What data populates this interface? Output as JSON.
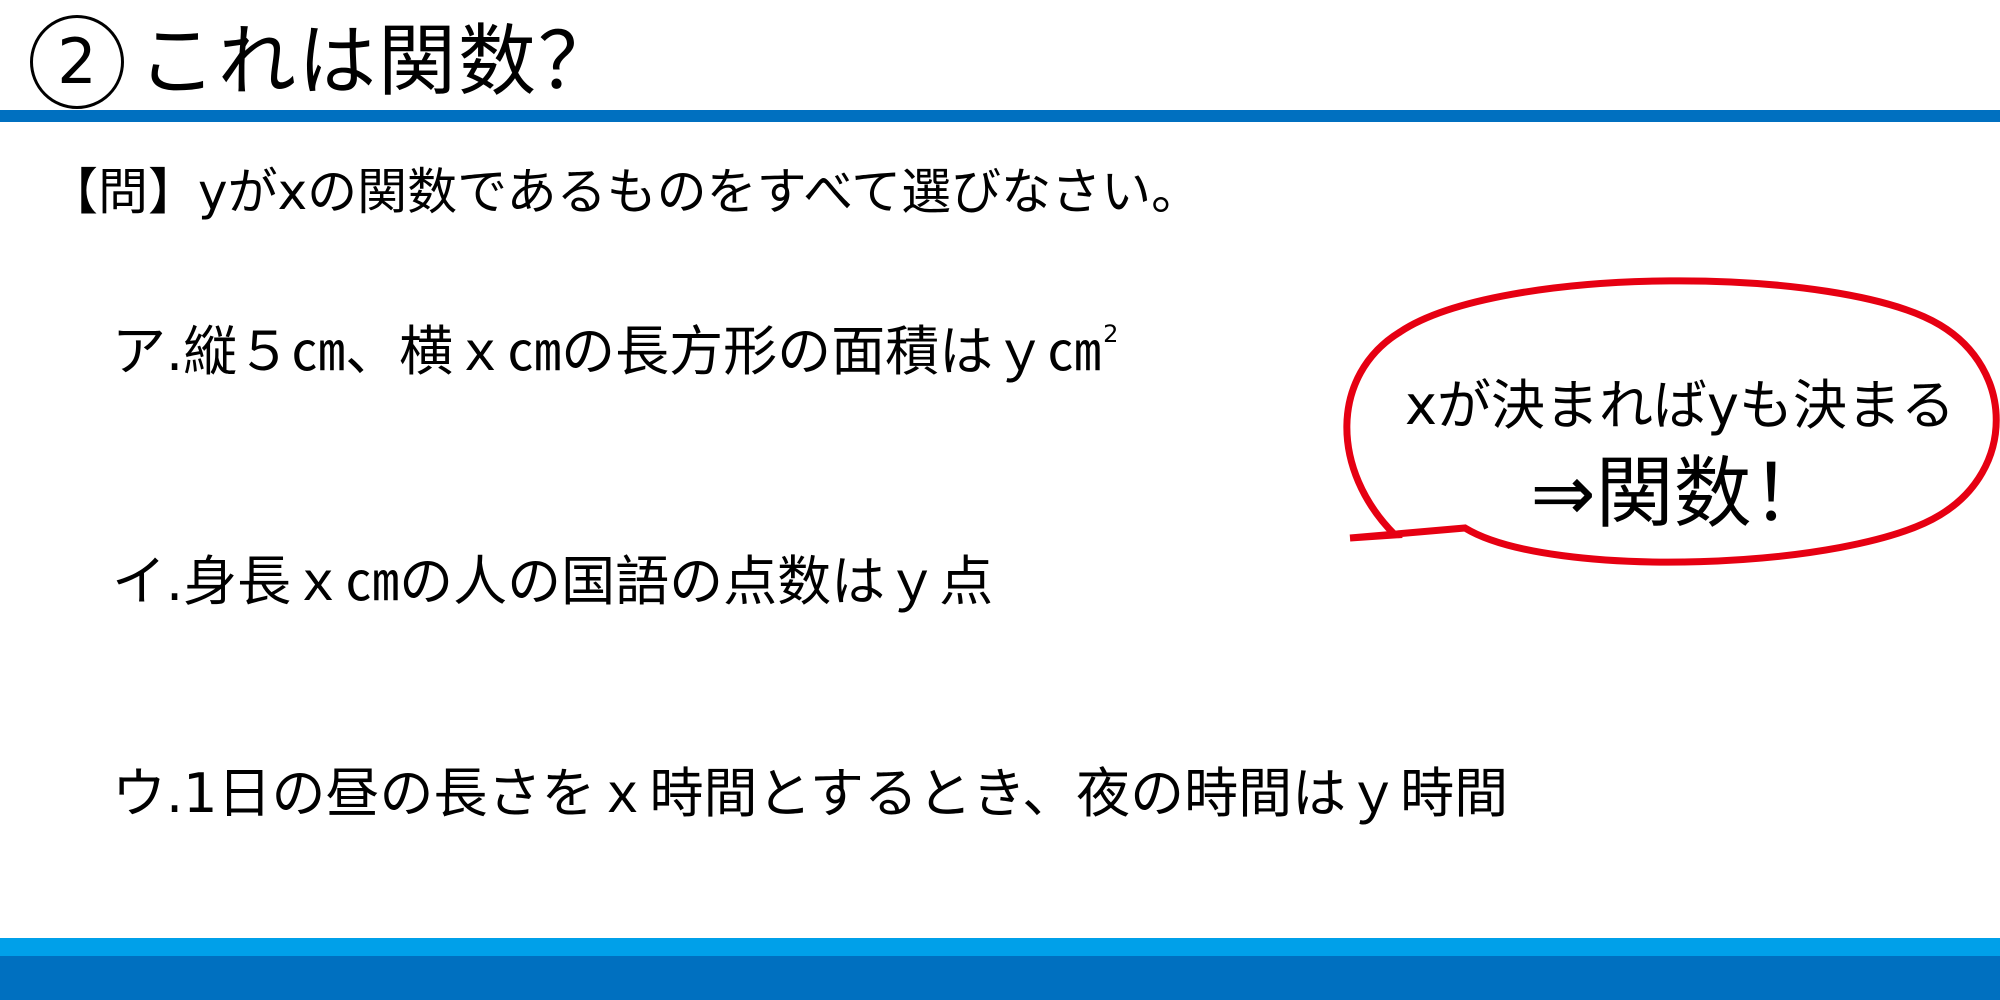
{
  "title": {
    "number": "2",
    "text": "これは関数？"
  },
  "question": {
    "text": "【問】yがxの関数であるものをすべて選びなさい。"
  },
  "options": [
    {
      "text": "ア.縦５㎝、横ｘ㎝の長方形の面積はｙ㎝",
      "superscript": "2"
    },
    {
      "text": "イ.身長ｘ㎝の人の国語の点数はｙ点"
    },
    {
      "text": "ウ.1日の昼の長さをｘ時間とするとき、夜の時間はｙ時間"
    }
  ],
  "callout": {
    "line1": "xが決まればyも決まる",
    "line2": "⇒関数！"
  },
  "colors": {
    "title_rule": "#0070c0",
    "footer_light": "#00a0e9",
    "footer_dark": "#0070c0",
    "callout_border": "#e60012"
  }
}
